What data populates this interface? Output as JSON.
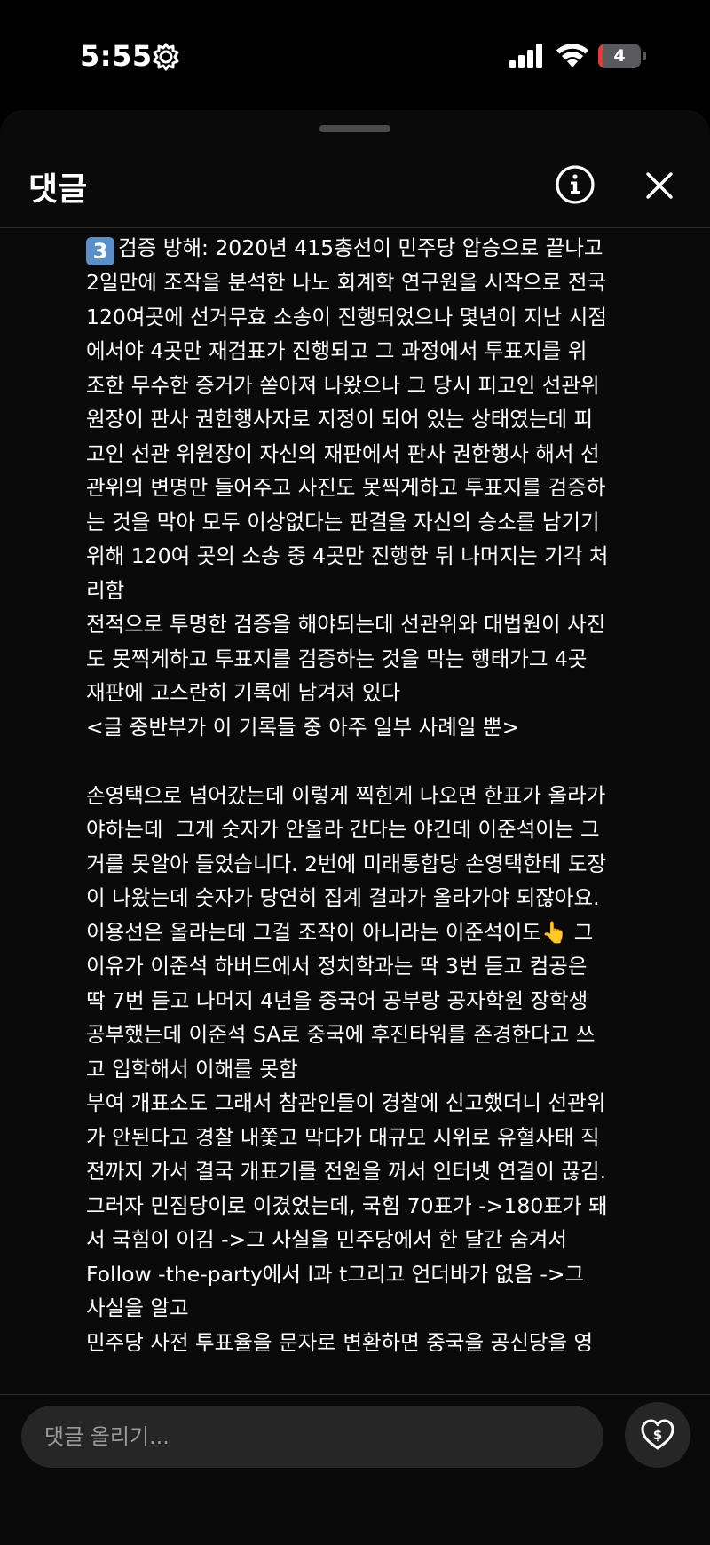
{
  "status_bar": {
    "time": "5:55",
    "battery_level": "4",
    "icons": [
      "gear-icon",
      "signal-icon",
      "wifi-icon",
      "battery-icon"
    ]
  },
  "sheet": {
    "title": "댓글",
    "info_icon": "info-icon",
    "close_icon": "close-icon"
  },
  "comment": {
    "keycap": "3",
    "text": "검증 방해: 2020년 415총선이 민주당 압승으로 끝나고\n2일만에 조작을 분석한 나노 회계학 연구원을 시작으로 전국\n120여곳에 선거무효 소송이 진행되었으나 몇년이 지난 시점\n에서야 4곳만 재검표가 진행되고 그 과정에서 투표지를 위\n조한 무수한 증거가 쏟아져 나왔으나 그 당시 피고인 선관위\n원장이 판사 권한행사자로 지정이 되어 있는 상태였는데 피\n고인 선관 위원장이 자신의 재판에서 판사 권한행사 해서 선\n관위의 변명만 들어주고 사진도 못찍게하고 투표지를 검증하\n는 것을 막아 모두 이상없다는 판결을 자신의 승소를 남기기\n위해 120여 곳의 소송 중 4곳만 진행한 뒤 나머지는 기각 처\n리함\n전적으로 투명한 검증을 해야되는데 선관위와 대법원이 사진\n도 못찍게하고 투표지를 검증하는 것을 막는 행태가그 4곳\n재판에 고스란히 기록에 남겨져 있다\n<글 중반부가 이 기록들 중 아주 일부 사례일 뿐>\n\n손영택으로 넘어갔는데 이렇게 찍힌게 나오면 한표가 올라가\n야하는데  그게 숫자가 안올라 간다는 야긴데 이준석이는 그\n거를 못알아 들었습니다. 2번에 미래통합당 손영택한테 도장\n이 나왔는데 숫자가 당연히 집계 결과가 올라가야 되잖아요.\n이용선은 올라는데 그걸 조작이 아니라는 이준석이도👆 그\n이유가 이준석 하버드에서 정치학과는 딱 3번 듣고 컴공은\n딱 7번 듣고 나머지 4년을 중국어 공부랑 공자학원 장학생\n공부했는데 이준석 SA로 중국에 후진타워를 존경한다고 쓰\n고 입학해서 이해를 못함\n부여 개표소도 그래서 참관인들이 경찰에 신고했더니 선관위\n가 안된다고 경찰 내쫓고 막다가 대규모 시위로 유혈사태 직\n전까지 가서 결국 개표기를 전원을 꺼서 인터넷 연결이 끊김.\n그러자 민짐당이로 이겼었는데, 국힘 70표가 ->180표가 돼\n서 국힘이 이김 ->그 사실을 민주당에서 한 달간 숨겨서\nFollow -the-party에서 l과 t그리고 언더바가 없음 ->그\n사실을 알고\n민주당 사전 투표율을 문자로 변환하면 중국을 공신당을 영"
  },
  "input": {
    "placeholder": "댓글 올리기...",
    "value": ""
  },
  "gift_icon": "heart-dollar-icon"
}
